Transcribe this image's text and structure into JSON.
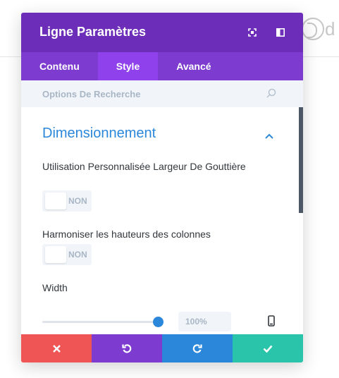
{
  "background": {
    "logo_letter": "d"
  },
  "modal": {
    "title": "Ligne Paramètres",
    "tabs": [
      {
        "label": "Contenu",
        "active": false
      },
      {
        "label": "Style",
        "active": true
      },
      {
        "label": "Avancé",
        "active": false
      }
    ],
    "search": {
      "placeholder": "Options De Recherche"
    },
    "section": {
      "title": "Dimensionnement",
      "fields": {
        "gutter_width": {
          "label": "Utilisation Personnalisée Largeur De Gouttière",
          "toggle": "NON"
        },
        "equalize_heights": {
          "label": "Harmoniser les hauteurs des colonnes",
          "toggle": "NON"
        },
        "width": {
          "label": "Width",
          "value": "100%",
          "slider_fraction": 1.0
        }
      }
    },
    "footer": {
      "buttons": [
        {
          "name": "cancel",
          "color": "#ef5555",
          "icon": "close-icon"
        },
        {
          "name": "undo",
          "color": "#7e3bd0",
          "icon": "undo-icon"
        },
        {
          "name": "redo",
          "color": "#2b87da",
          "icon": "redo-icon"
        },
        {
          "name": "save",
          "color": "#29c4a9",
          "icon": "check-icon"
        }
      ]
    },
    "colors": {
      "header": "#6c2eb9",
      "tabs": "#7e3bd0",
      "tab_active": "#8f42ec",
      "accent": "#2b87da"
    }
  }
}
